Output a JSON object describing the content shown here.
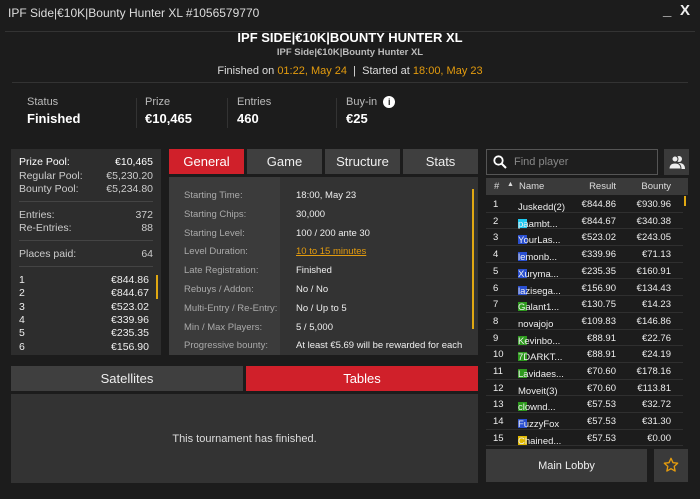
{
  "window": {
    "title": "IPF Side|€10K|Bounty Hunter XL #1056579770",
    "minimize": "_",
    "close": "X"
  },
  "header": {
    "title": "IPF SIDE|€10K|BOUNTY HUNTER XL",
    "subtitle": "IPF Side|€10K|Bounty Hunter XL",
    "finished_label": "Finished on",
    "finished_value": "01:22, May 24",
    "sep": "|",
    "started_label": "Started at",
    "started_value": "18:00, May 23"
  },
  "stats": [
    {
      "label": "Status",
      "value": "Finished"
    },
    {
      "label": "Prize",
      "value": "€10,465"
    },
    {
      "label": "Entries",
      "value": "460"
    },
    {
      "label": "Buy-in",
      "value": "€25"
    }
  ],
  "pool": {
    "prize_pool_label": "Prize Pool:",
    "prize_pool": "€10,465",
    "regular_label": "Regular Pool:",
    "regular": "€5,230.20",
    "bounty_label": "Bounty Pool:",
    "bounty": "€5,234.80",
    "entries_label": "Entries:",
    "entries": "372",
    "reentries_label": "Re-Entries:",
    "reentries": "88",
    "places_label": "Places paid:",
    "places": "64",
    "payouts": [
      {
        "place": "1",
        "amount": "€844.86"
      },
      {
        "place": "2",
        "amount": "€844.67"
      },
      {
        "place": "3",
        "amount": "€523.02"
      },
      {
        "place": "4",
        "amount": "€339.96"
      },
      {
        "place": "5",
        "amount": "€235.35"
      },
      {
        "place": "6",
        "amount": "€156.90"
      }
    ]
  },
  "tabs": [
    "General",
    "Game",
    "Structure",
    "Stats"
  ],
  "general": [
    {
      "label": "Starting Time:",
      "value": "18:00, May 23"
    },
    {
      "label": "Starting Chips:",
      "value": "30,000"
    },
    {
      "label": "Starting Level:",
      "value": "100 / 200 ante 30"
    },
    {
      "label": "Level Duration:",
      "value": "10 to 15 minutes"
    },
    {
      "label": "Late Registration:",
      "value": "Finished"
    },
    {
      "label": "Rebuys / Addon:",
      "value": "No / No"
    },
    {
      "label": "Multi-Entry / Re-Entry:",
      "value": "No / Up to 5"
    },
    {
      "label": "Min / Max Players:",
      "value": "5 / 5,000"
    },
    {
      "label": "Progressive bounty:",
      "value": "At least €5.69 will be rewarded for each"
    }
  ],
  "bottom_tabs": [
    "Satellites",
    "Tables"
  ],
  "bottom_message": "This tournament has finished.",
  "search": {
    "placeholder": "Find player"
  },
  "players_table": {
    "headers": [
      "#",
      "Name",
      "Result",
      "Bounty"
    ],
    "rows": [
      {
        "rank": "1",
        "name": "Juskedd(2)",
        "color": "",
        "result": "€844.86",
        "bounty": "€930.96"
      },
      {
        "rank": "2",
        "name": "paambt...",
        "color": "#1ec8f0",
        "result": "€844.67",
        "bounty": "€340.38"
      },
      {
        "rank": "3",
        "name": "YourLas...",
        "color": "#2a4fd0",
        "result": "€523.02",
        "bounty": "€243.05"
      },
      {
        "rank": "4",
        "name": "lemonb...",
        "color": "#2a4fd0",
        "result": "€339.96",
        "bounty": "€71.13"
      },
      {
        "rank": "5",
        "name": "Xuryma...",
        "color": "#2a4fd0",
        "result": "€235.35",
        "bounty": "€160.91"
      },
      {
        "rank": "6",
        "name": "lazisega...",
        "color": "#2a4fd0",
        "result": "€156.90",
        "bounty": "€134.43"
      },
      {
        "rank": "7",
        "name": "Galant1...",
        "color": "#2e9a1e",
        "result": "€130.75",
        "bounty": "€14.23"
      },
      {
        "rank": "8",
        "name": "novajojo",
        "color": "",
        "result": "€109.83",
        "bounty": "€146.86"
      },
      {
        "rank": "9",
        "name": "Kevinbo...",
        "color": "#2e9a1e",
        "result": "€88.91",
        "bounty": "€22.76"
      },
      {
        "rank": "10",
        "name": "7DARKT...",
        "color": "#2e9a1e",
        "result": "€88.91",
        "bounty": "€24.19"
      },
      {
        "rank": "11",
        "name": "Lavidaes...",
        "color": "#2e9a1e",
        "result": "€70.60",
        "bounty": "€178.16"
      },
      {
        "rank": "12",
        "name": "Moveit(3)",
        "color": "",
        "result": "€70.60",
        "bounty": "€113.81"
      },
      {
        "rank": "13",
        "name": "clownd...",
        "color": "#2e9a1e",
        "result": "€57.53",
        "bounty": "€32.72"
      },
      {
        "rank": "14",
        "name": "FuzzyFox",
        "color": "#2a4fd0",
        "result": "€57.53",
        "bounty": "€31.30"
      },
      {
        "rank": "15",
        "name": "Chained...",
        "color": "#e0b800",
        "result": "€57.53",
        "bounty": "€0.00"
      }
    ]
  },
  "main_lobby": "Main Lobby",
  "colors": {
    "accent": "#d0202a",
    "highlight": "#e39b0e"
  }
}
